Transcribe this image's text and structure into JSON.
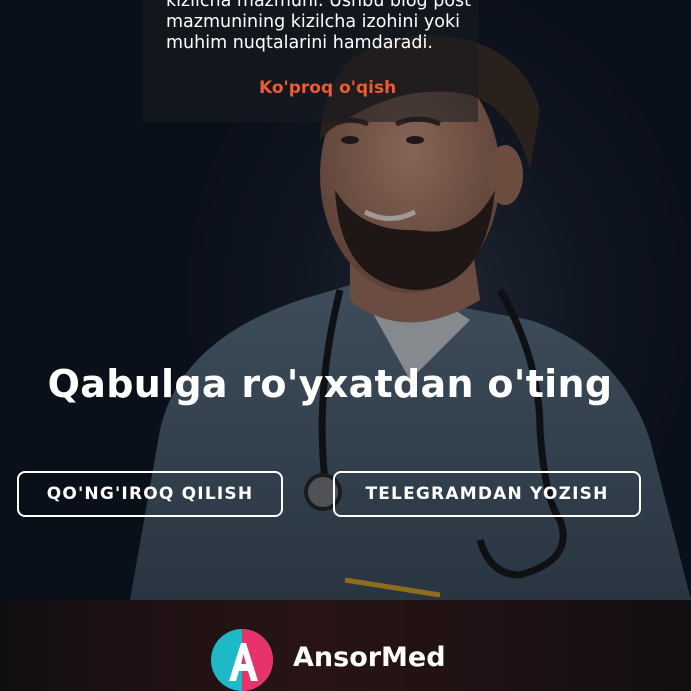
{
  "blog": {
    "excerpt": "kizilcha mazmuni. Ushbu blog post mazmunining kizilcha izohini yoki muhim nuqtalarini hamdaradi.",
    "read_more": "Ko'proq o'qish"
  },
  "cta": {
    "title": "Qabulga ro'yxatdan o'ting",
    "call_button": "QO'NG'IROQ QILISH",
    "telegram_button": "TELEGRAMDAN YOZISH"
  },
  "footer": {
    "brand_name": "AnsorMed",
    "logo_letter": "A"
  },
  "colors": {
    "accent": "#ef5a33",
    "background": "#0c111c",
    "logo_teal": "#1db9c6",
    "logo_pink": "#e6336b"
  }
}
